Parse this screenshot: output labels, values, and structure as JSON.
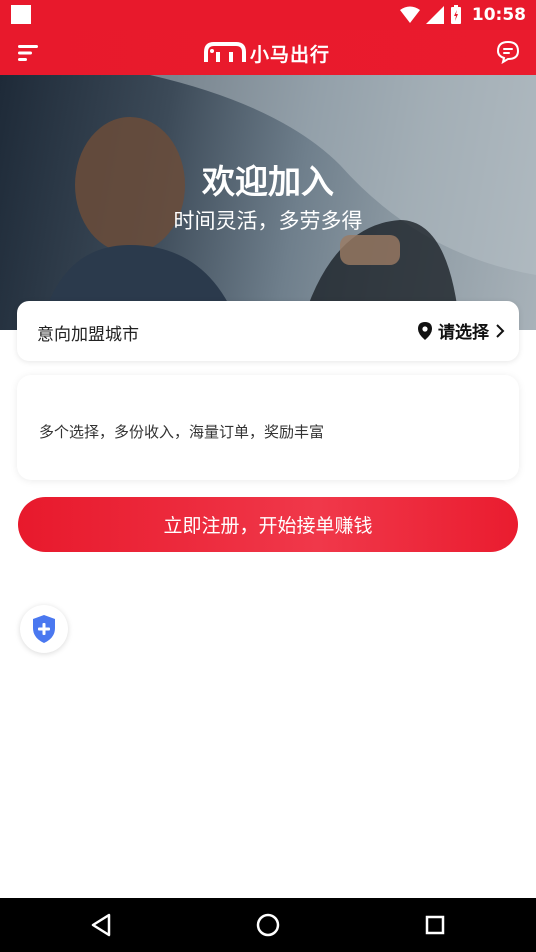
{
  "status_bar": {
    "time": "10:58"
  },
  "header": {
    "logo_text": "小马出行"
  },
  "hero": {
    "title": "欢迎加入",
    "subtitle": "时间灵活，多劳多得"
  },
  "city": {
    "label": "意向加盟城市",
    "select_text": "请选择"
  },
  "description": {
    "text": "多个选择，多份收入，海量订单，奖励丰富"
  },
  "register": {
    "button_label": "立即注册，开始接单赚钱"
  },
  "colors": {
    "brand": "#e8192c",
    "shield": "#4a78f0"
  },
  "icons": [
    "menu-icon",
    "logo-horse-icon",
    "chat-icon",
    "location-pin-icon",
    "chevron-right-icon",
    "shield-plus-icon",
    "back-icon",
    "home-icon",
    "recents-icon"
  ]
}
